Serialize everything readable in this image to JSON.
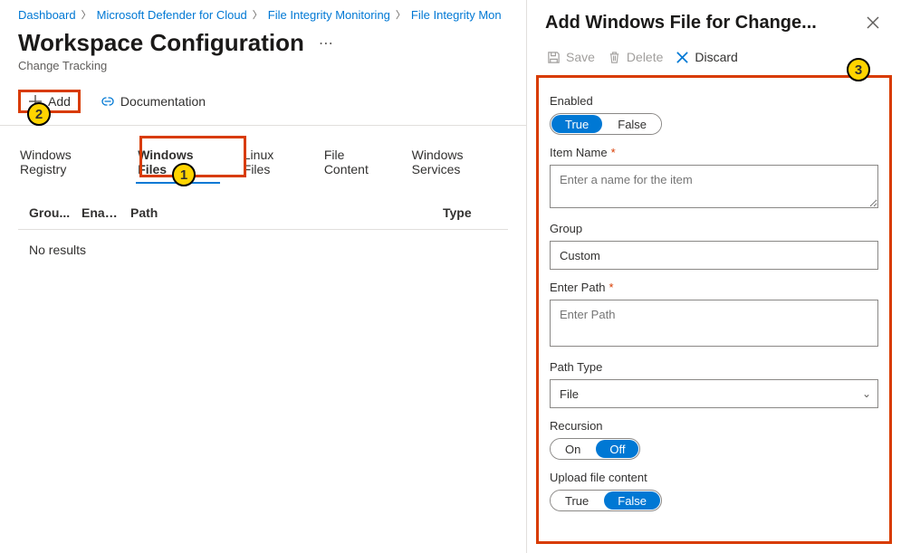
{
  "breadcrumb": {
    "items": [
      {
        "label": "Dashboard"
      },
      {
        "label": "Microsoft Defender for Cloud"
      },
      {
        "label": "File Integrity Monitoring"
      },
      {
        "label": "File Integrity Mon"
      }
    ]
  },
  "page": {
    "title": "Workspace Configuration",
    "subtitle": "Change Tracking"
  },
  "toolbar": {
    "add_label": "Add",
    "doc_label": "Documentation"
  },
  "tabs": [
    {
      "label": "Windows Registry"
    },
    {
      "label": "Windows Files"
    },
    {
      "label": "Linux Files"
    },
    {
      "label": "File Content"
    },
    {
      "label": "Windows Services"
    }
  ],
  "table": {
    "cols": {
      "group": "Grou...",
      "enable": "Enab...",
      "path": "Path",
      "type": "Type"
    },
    "no_results": "No results"
  },
  "callouts": {
    "one": "1",
    "two": "2",
    "three": "3"
  },
  "panel": {
    "title": "Add Windows File for Change...",
    "tools": {
      "save": "Save",
      "delete": "Delete",
      "discard": "Discard"
    },
    "fields": {
      "enabled": {
        "label": "Enabled",
        "opt_true": "True",
        "opt_false": "False"
      },
      "item_name": {
        "label": "Item Name",
        "placeholder": "Enter a name for the item"
      },
      "group": {
        "label": "Group",
        "value": "Custom"
      },
      "enter_path": {
        "label": "Enter Path",
        "placeholder": "Enter Path"
      },
      "path_type": {
        "label": "Path Type",
        "value": "File"
      },
      "recursion": {
        "label": "Recursion",
        "opt_on": "On",
        "opt_off": "Off"
      },
      "upload": {
        "label": "Upload file content",
        "opt_true": "True",
        "opt_false": "False"
      }
    }
  }
}
